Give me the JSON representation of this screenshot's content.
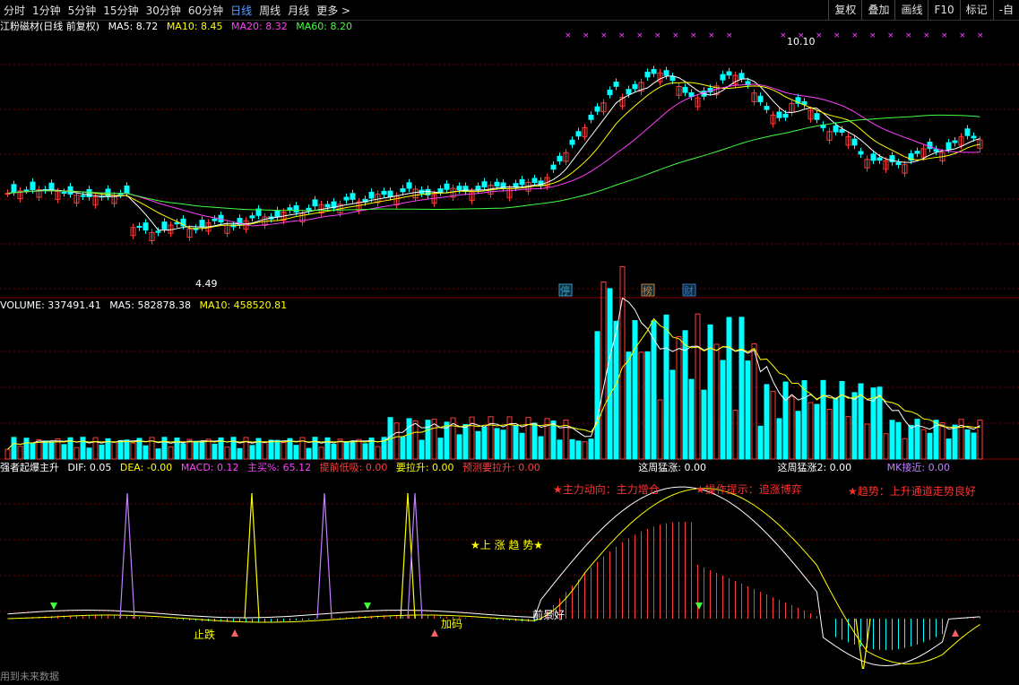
{
  "toolbar": {
    "tabs": [
      "分时",
      "1分钟",
      "5分钟",
      "15分钟",
      "30分钟",
      "60分钟",
      "日线",
      "周线",
      "月线",
      "更多 >"
    ],
    "active_index": 6,
    "right_buttons": [
      "复权",
      "叠加",
      "画线",
      "F10",
      "标记",
      "-自"
    ]
  },
  "main_panel": {
    "title": "江粉磁材(日线 前复权)",
    "ma_labels": [
      {
        "name": "MA5",
        "text": "MA5: 8.72",
        "color": "#ffffff"
      },
      {
        "name": "MA10",
        "text": "MA10: 8.45",
        "color": "#ffff00"
      },
      {
        "name": "MA20",
        "text": "MA20: 8.32",
        "color": "#ff40ff"
      },
      {
        "name": "MA60",
        "text": "MA60: 8.20",
        "color": "#40ff40"
      }
    ],
    "high_label": "10.10",
    "low_label": "4.49",
    "event_tags": [
      {
        "text": "停",
        "color": "#3aa0c8"
      },
      {
        "text": "榜",
        "color": "#d08040"
      },
      {
        "text": "财",
        "color": "#3a78c8"
      }
    ]
  },
  "volume_panel": {
    "labels": [
      {
        "text": "VOLUME: 337491.41",
        "color": "#ffffff"
      },
      {
        "text": "MA5: 582878.38",
        "color": "#ffffff"
      },
      {
        "text": "MA10: 458520.81",
        "color": "#ffff00"
      }
    ]
  },
  "indicator_panel": {
    "labels": [
      {
        "text": "强者起爆主升",
        "color": "#ffffff"
      },
      {
        "text": "DIF: 0.05",
        "color": "#ffffff"
      },
      {
        "text": "DEA: -0.00",
        "color": "#ffff00"
      },
      {
        "text": "MACD: 0.12",
        "color": "#ff40ff"
      },
      {
        "text": "主买%: 65.12",
        "color": "#ff40ff"
      },
      {
        "text": "提前低吸: 0.00",
        "color": "#ff4040"
      },
      {
        "text": "要拉升: 0.00",
        "color": "#ffff00"
      },
      {
        "text": "预测要拉升: 0.00",
        "color": "#ff4040"
      },
      {
        "text": "这周猛涨: 0.00",
        "color": "#ffffff"
      },
      {
        "text": "这周猛涨2: 0.00",
        "color": "#ffffff"
      },
      {
        "text": "MK接近: 0.00",
        "color": "#c080ff"
      }
    ],
    "annotations": {
      "main_force": "★主力动向：主力增仓",
      "operation": "★操作提示：追涨博弈",
      "trend": "★趋势：上升通道走势良好",
      "uptrend": "★上 涨 趋 势★",
      "stop_fall": "止跌",
      "add_position": "加码",
      "prospect": "前景好"
    }
  },
  "footer": {
    "text": "用到未来数据"
  },
  "colors": {
    "up": "#ff3c3c",
    "down": "#00ffff",
    "ma5": "#ffffff",
    "ma10": "#ffff00",
    "ma20": "#ff40ff",
    "ma60": "#40ff40",
    "grid": "#7a0000"
  }
}
